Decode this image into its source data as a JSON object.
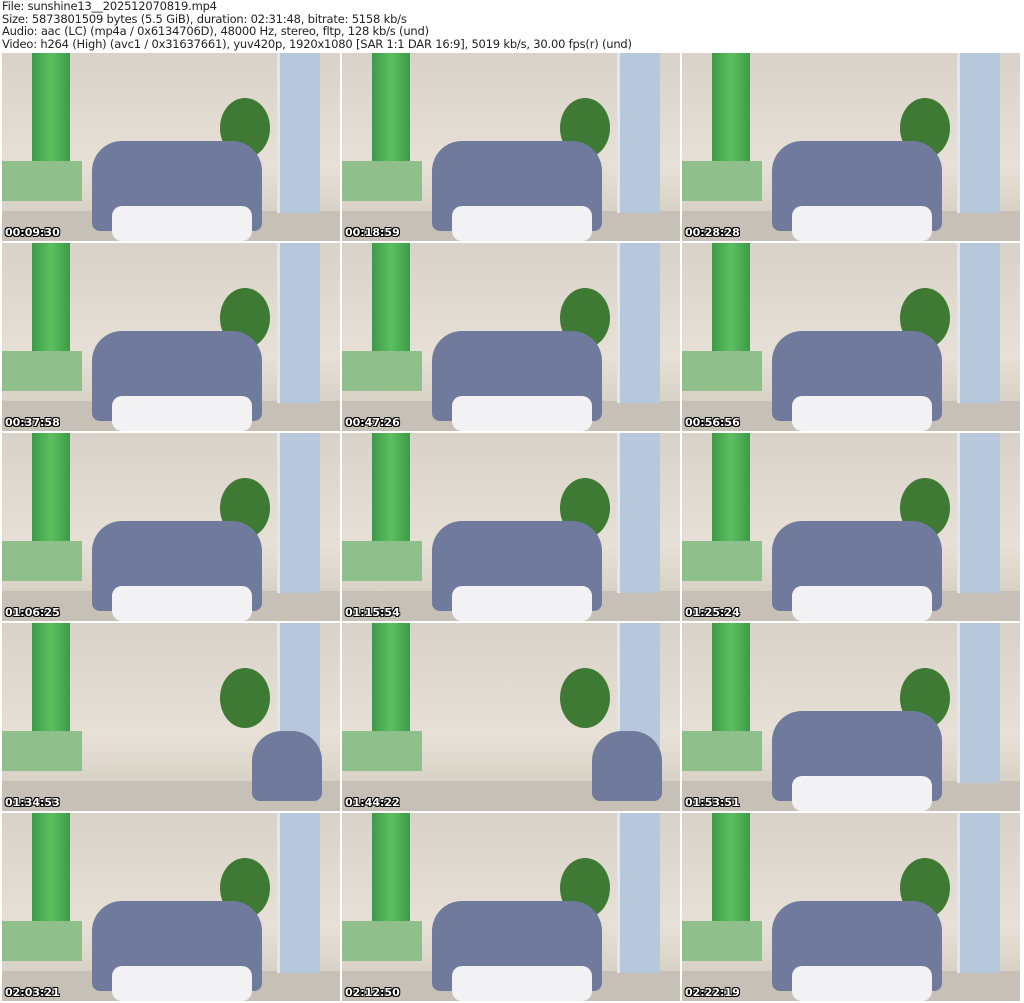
{
  "header": {
    "file": "File: sunshine13__202512070819.mp4",
    "size": "Size: 5873801509 bytes (5.5 GiB), duration: 02:31:48, bitrate: 5158 kb/s",
    "audio": "Audio: aac (LC) (mp4a / 0x6134706D), 48000 Hz, stereo, fltp, 128 kb/s (und)",
    "video": "Video: h264 (High) (avc1 / 0x31637661), yuv420p, 1920x1080 [SAR 1:1 DAR 16:9], 5019 kb/s, 30.00 fps(r) (und)"
  },
  "thumbnails": [
    {
      "timestamp": "00:09:30"
    },
    {
      "timestamp": "00:18:59"
    },
    {
      "timestamp": "00:28:28"
    },
    {
      "timestamp": "00:37:58"
    },
    {
      "timestamp": "00:47:26"
    },
    {
      "timestamp": "00:56:56"
    },
    {
      "timestamp": "01:06:25"
    },
    {
      "timestamp": "01:15:54"
    },
    {
      "timestamp": "01:25:24"
    },
    {
      "timestamp": "01:34:53"
    },
    {
      "timestamp": "01:44:22"
    },
    {
      "timestamp": "01:53:51"
    },
    {
      "timestamp": "02:03:21"
    },
    {
      "timestamp": "02:12:50"
    },
    {
      "timestamp": "02:22:19"
    }
  ]
}
